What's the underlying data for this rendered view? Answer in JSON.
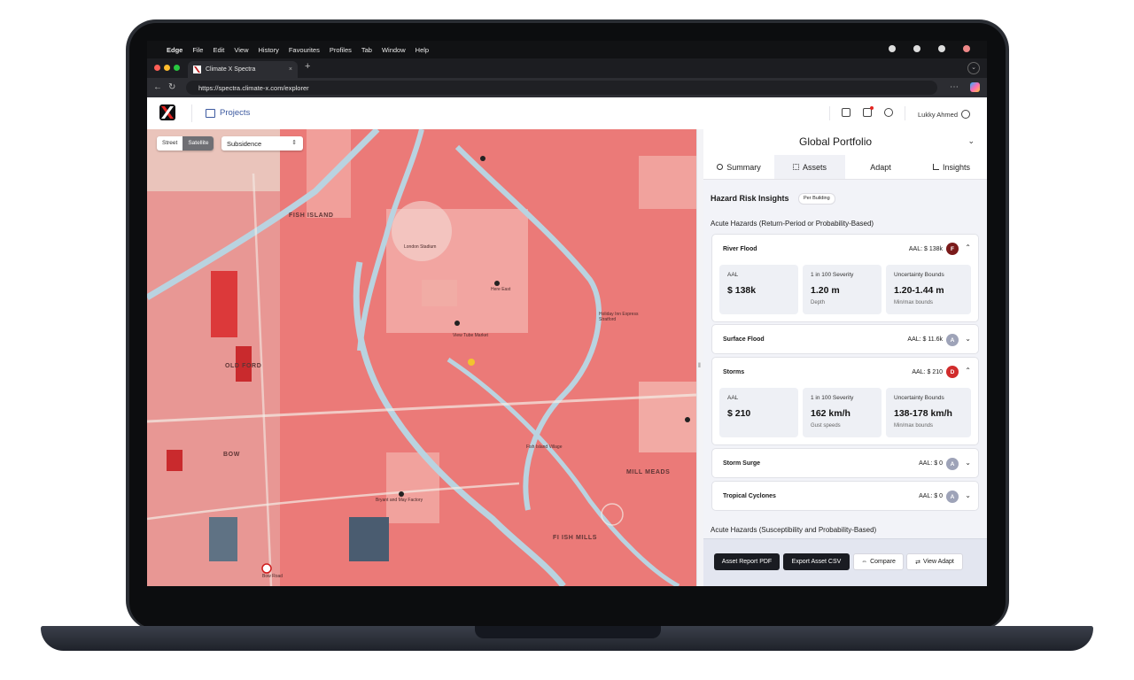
{
  "os_menubar": {
    "apple": "",
    "items": [
      "Edge",
      "File",
      "Edit",
      "View",
      "History",
      "Favourites",
      "Profiles",
      "Tab",
      "Window",
      "Help"
    ]
  },
  "browser": {
    "tab_title": "Climate X Spectra",
    "tab_close": "×",
    "new_tab": "+",
    "url": "https://spectra.climate-x.com/explorer",
    "more": "⋯"
  },
  "app_header": {
    "projects_label": "Projects",
    "user_name": "Lukky Ahmed"
  },
  "map": {
    "view_toggle": {
      "street": "Street",
      "satellite": "Satellite",
      "active": "satellite"
    },
    "layer_select": "Subsidence",
    "labels": [
      "FISH ISLAND",
      "OLD FORD",
      "BOW",
      "MILL MEADS",
      "FI ISH MILLS"
    ],
    "poi_labels": [
      "London Stadium",
      "View Tube Market",
      "Here East",
      "Holiday Inn Express Stratford",
      "Fish Island Village",
      "Bryant and May Factory",
      "Bow Road"
    ],
    "colors": {
      "hazard_overlay": "#ef6b6b",
      "water": "#b9d3e0",
      "road": "#f4ede6"
    }
  },
  "panel": {
    "portfolio_title": "Global Portfolio",
    "tabs": [
      {
        "label": "Summary"
      },
      {
        "label": "Assets"
      },
      {
        "label": "Adapt"
      },
      {
        "label": "Insights"
      }
    ],
    "active_tab": "Assets",
    "section_title": "Hazard Risk Insights",
    "section_badge": "Per Building",
    "acute_title_1": "Acute Hazards (Return-Period or Probability-Based)",
    "acute_title_2": "Acute Hazards (Susceptibility and Probability-Based)",
    "hazards": [
      {
        "name": "River Flood",
        "aal": "AAL: $ 138k",
        "grade": "F",
        "grade_color": "#7a1a1a",
        "expanded": true,
        "metrics": [
          {
            "label": "AAL",
            "value": "$ 138k",
            "note": ""
          },
          {
            "label": "1 in 100 Severity",
            "value": "1.20 m",
            "note": "Depth"
          },
          {
            "label": "Uncertainty Bounds",
            "value": "1.20-1.44 m",
            "note": "Min/max bounds"
          }
        ]
      },
      {
        "name": "Surface Flood",
        "aal": "AAL: $ 11.6k",
        "grade": "A",
        "grade_color": "#9ea3b8",
        "expanded": false
      },
      {
        "name": "Storms",
        "aal": "AAL: $ 210",
        "grade": "D",
        "grade_color": "#d12b2b",
        "expanded": true,
        "metrics": [
          {
            "label": "AAL",
            "value": "$ 210",
            "note": ""
          },
          {
            "label": "1 in 100 Severity",
            "value": "162 km/h",
            "note": "Gust speeds"
          },
          {
            "label": "Uncertainty Bounds",
            "value": "138-178 km/h",
            "note": "Min/max bounds"
          }
        ]
      },
      {
        "name": "Storm Surge",
        "aal": "AAL: $ 0",
        "grade": "A",
        "grade_color": "#9ea3b8",
        "expanded": false
      },
      {
        "name": "Tropical Cyclones",
        "aal": "AAL: $ 0",
        "grade": "A",
        "grade_color": "#9ea3b8",
        "expanded": false
      }
    ],
    "footer_buttons": {
      "report_pdf": "Asset Report PDF",
      "export_csv": "Export Asset CSV",
      "compare": "Compare",
      "view_adapt": "View Adapt"
    }
  }
}
